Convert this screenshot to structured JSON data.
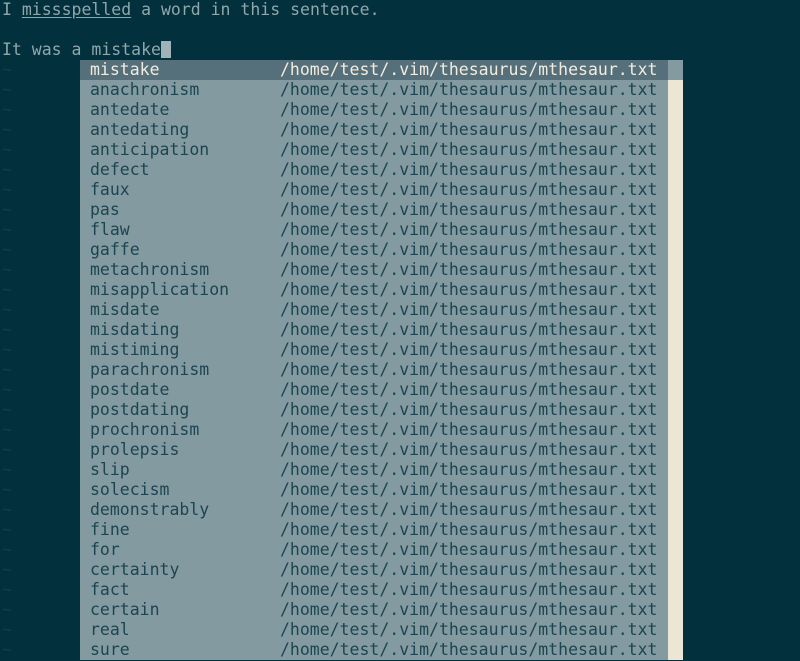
{
  "terminal": {
    "background_color": "#02303c",
    "foreground_color": "#8fa7ad",
    "cursor_color": "#9fb3b8",
    "tilde_color": "#0b4251"
  },
  "buffer": {
    "line1_prefix": "I ",
    "line1_misspelled_word": "missspelled",
    "line1_suffix": " a word in this sentence.",
    "line2_blank": "",
    "line3_text": "It was a mistake",
    "tilde_char": "~",
    "tilde_row_count": 30
  },
  "popup": {
    "background_color": "#839aa0",
    "text_color": "#1d4551",
    "selected_background_color": "#55707a",
    "selected_text_color": "#f2ece0",
    "scrollbar_thumb_color": "#ece6d4",
    "scrollbar_track_color": "#839aa0",
    "source_path": "/home/test/.vim/thesaurus/mthesaur.txt",
    "selected_index": 0,
    "items": [
      {
        "word": "mistake",
        "path": "/home/test/.vim/thesaurus/mthesaur.txt"
      },
      {
        "word": "anachronism",
        "path": "/home/test/.vim/thesaurus/mthesaur.txt"
      },
      {
        "word": "antedate",
        "path": "/home/test/.vim/thesaurus/mthesaur.txt"
      },
      {
        "word": "antedating",
        "path": "/home/test/.vim/thesaurus/mthesaur.txt"
      },
      {
        "word": "anticipation",
        "path": "/home/test/.vim/thesaurus/mthesaur.txt"
      },
      {
        "word": "defect",
        "path": "/home/test/.vim/thesaurus/mthesaur.txt"
      },
      {
        "word": "faux",
        "path": "/home/test/.vim/thesaurus/mthesaur.txt"
      },
      {
        "word": "pas",
        "path": "/home/test/.vim/thesaurus/mthesaur.txt"
      },
      {
        "word": "flaw",
        "path": "/home/test/.vim/thesaurus/mthesaur.txt"
      },
      {
        "word": "gaffe",
        "path": "/home/test/.vim/thesaurus/mthesaur.txt"
      },
      {
        "word": "metachronism",
        "path": "/home/test/.vim/thesaurus/mthesaur.txt"
      },
      {
        "word": "misapplication",
        "path": "/home/test/.vim/thesaurus/mthesaur.txt"
      },
      {
        "word": "misdate",
        "path": "/home/test/.vim/thesaurus/mthesaur.txt"
      },
      {
        "word": "misdating",
        "path": "/home/test/.vim/thesaurus/mthesaur.txt"
      },
      {
        "word": "mistiming",
        "path": "/home/test/.vim/thesaurus/mthesaur.txt"
      },
      {
        "word": "parachronism",
        "path": "/home/test/.vim/thesaurus/mthesaur.txt"
      },
      {
        "word": "postdate",
        "path": "/home/test/.vim/thesaurus/mthesaur.txt"
      },
      {
        "word": "postdating",
        "path": "/home/test/.vim/thesaurus/mthesaur.txt"
      },
      {
        "word": "prochronism",
        "path": "/home/test/.vim/thesaurus/mthesaur.txt"
      },
      {
        "word": "prolepsis",
        "path": "/home/test/.vim/thesaurus/mthesaur.txt"
      },
      {
        "word": "slip",
        "path": "/home/test/.vim/thesaurus/mthesaur.txt"
      },
      {
        "word": "solecism",
        "path": "/home/test/.vim/thesaurus/mthesaur.txt"
      },
      {
        "word": "demonstrably",
        "path": "/home/test/.vim/thesaurus/mthesaur.txt"
      },
      {
        "word": "fine",
        "path": "/home/test/.vim/thesaurus/mthesaur.txt"
      },
      {
        "word": "for",
        "path": "/home/test/.vim/thesaurus/mthesaur.txt"
      },
      {
        "word": "certainty",
        "path": "/home/test/.vim/thesaurus/mthesaur.txt"
      },
      {
        "word": "fact",
        "path": "/home/test/.vim/thesaurus/mthesaur.txt"
      },
      {
        "word": "certain",
        "path": "/home/test/.vim/thesaurus/mthesaur.txt"
      },
      {
        "word": "real",
        "path": "/home/test/.vim/thesaurus/mthesaur.txt"
      },
      {
        "word": "sure",
        "path": "/home/test/.vim/thesaurus/mthesaur.txt"
      }
    ]
  }
}
